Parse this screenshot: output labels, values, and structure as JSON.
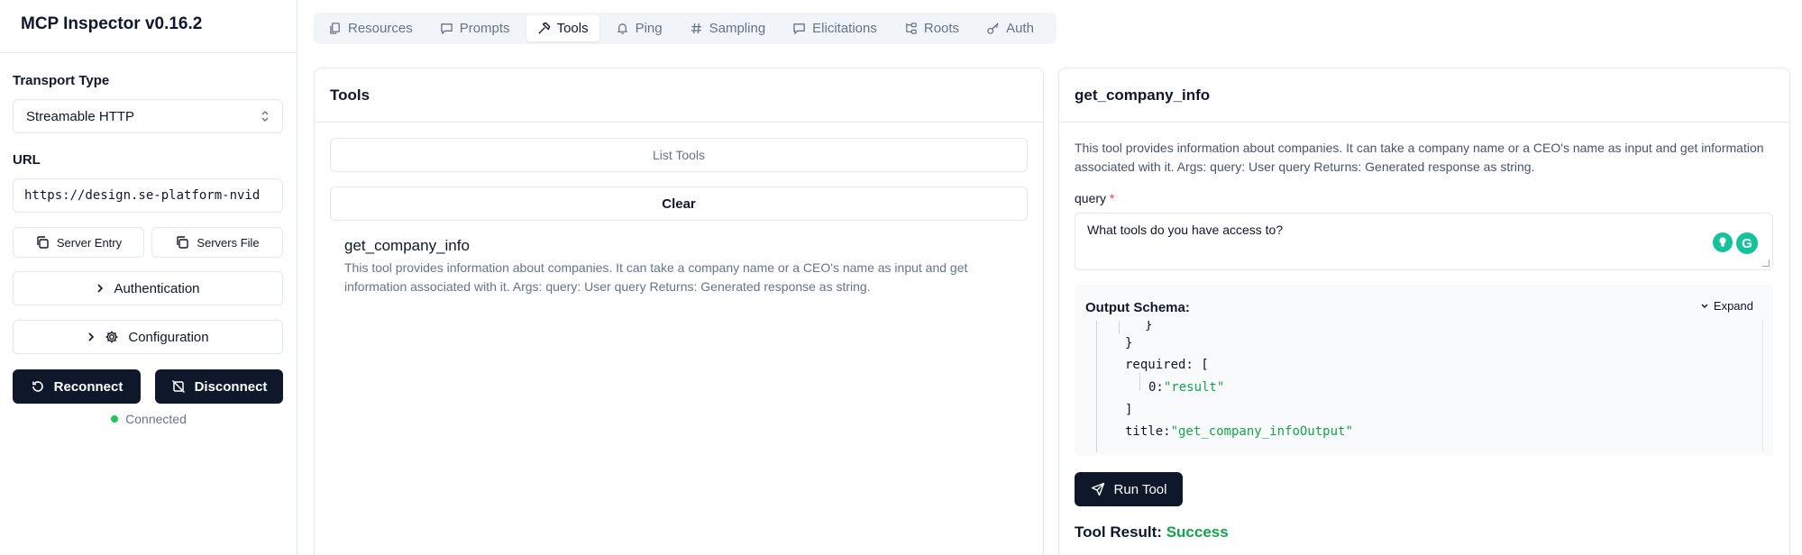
{
  "app": {
    "title": "MCP Inspector v0.16.2"
  },
  "sidebar": {
    "transport_label": "Transport Type",
    "transport_value": "Streamable HTTP",
    "url_label": "URL",
    "url_value": "https://design.se-platform-nvid",
    "server_entry": "Server Entry",
    "servers_file": "Servers File",
    "authentication": "Authentication",
    "configuration": "Configuration",
    "reconnect": "Reconnect",
    "disconnect": "Disconnect",
    "status": "Connected"
  },
  "tabs": [
    {
      "label": "Resources",
      "icon": "files-icon"
    },
    {
      "label": "Prompts",
      "icon": "message-icon"
    },
    {
      "label": "Tools",
      "icon": "hammer-icon",
      "active": true
    },
    {
      "label": "Ping",
      "icon": "bell-icon"
    },
    {
      "label": "Sampling",
      "icon": "hash-icon"
    },
    {
      "label": "Elicitations",
      "icon": "message-icon"
    },
    {
      "label": "Roots",
      "icon": "folder-tree-icon"
    },
    {
      "label": "Auth",
      "icon": "key-icon"
    }
  ],
  "tools_panel": {
    "title": "Tools",
    "list_tools": "List Tools",
    "clear": "Clear",
    "items": [
      {
        "name": "get_company_info",
        "description": "This tool provides information about companies. It can take a company name or a CEO's name as input and get information associated with it. Args: query: User query Returns: Generated response as string."
      }
    ]
  },
  "detail_panel": {
    "title": "get_company_info",
    "description": "This tool provides information about companies. It can take a company name or a CEO's name as input and get information associated with it. Args: query: User query Returns: Generated response as string.",
    "query_label": "query",
    "required_mark": "*",
    "query_value": "What tools do you have access to?",
    "output_schema_label": "Output Schema:",
    "expand_label": "Expand",
    "code": {
      "l1": "}",
      "l2": "}",
      "l3_key": "required:",
      "l3_bracket": "[",
      "l4_key": "0:",
      "l4_val": "\"result\"",
      "l5": "]",
      "l6_key": "title:",
      "l6_val": "\"get_company_infoOutput\""
    },
    "run_tool": "Run Tool",
    "result_label": "Tool Result:",
    "result_status": "Success"
  },
  "colors": {
    "primary": "#0f172a",
    "success": "#16a34a",
    "status_dot": "#22c55e",
    "required": "#ef4444",
    "grammarly": "#15c39a"
  }
}
